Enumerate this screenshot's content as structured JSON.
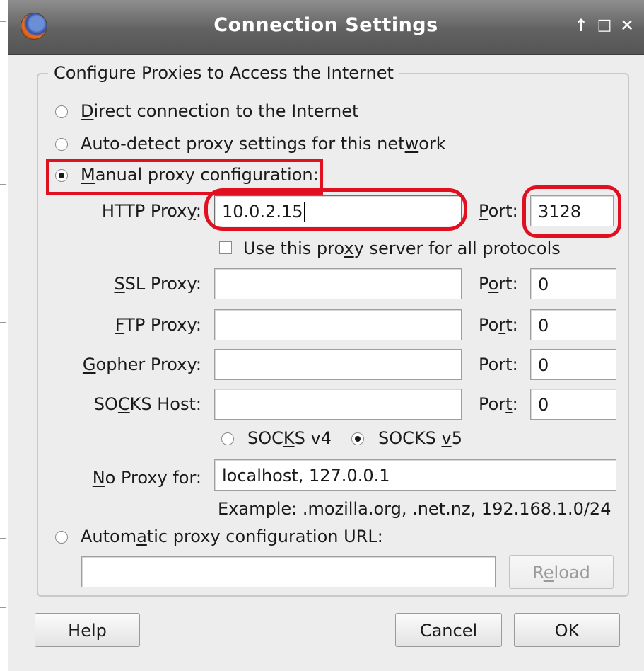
{
  "window": {
    "title": "Connection Settings",
    "controls": {
      "up": "↑",
      "maximize": "□",
      "close": "✕"
    }
  },
  "group": {
    "title": "Configure Proxies to Access the Internet"
  },
  "options": {
    "direct": {
      "before": "",
      "key": "D",
      "after": "irect connection to the Internet"
    },
    "autodetect": {
      "before": "Auto-detect proxy settings for this net",
      "key": "w",
      "after": "ork"
    },
    "manual": {
      "before": "",
      "key": "M",
      "after": "anual proxy configuration:"
    },
    "auto_url": {
      "before": "Autom",
      "key": "a",
      "after": "tic proxy configuration URL:"
    },
    "selected": "manual"
  },
  "proxies": {
    "http": {
      "label_before": "HTTP Prox",
      "label_key": "y",
      "label_after": ":",
      "value": "10.0.2.15",
      "port_before": "",
      "port_key": "P",
      "port_after": "ort:",
      "port": "3128"
    },
    "use_all": {
      "before": "Use this pro",
      "key": "x",
      "after": "y server for all protocols",
      "checked": false
    },
    "ssl": {
      "label_before": "",
      "label_key": "S",
      "label_after": "SL Proxy:",
      "value": "",
      "port_before": "P",
      "port_key": "o",
      "port_after": "rt:",
      "port": "0"
    },
    "ftp": {
      "label_before": "",
      "label_key": "F",
      "label_after": "TP Proxy:",
      "value": "",
      "port_before": "Po",
      "port_key": "r",
      "port_after": "t:",
      "port": "0"
    },
    "gopher": {
      "label_before": "",
      "label_key": "G",
      "label_after": "opher Proxy:",
      "value": "",
      "port_before": "Port:",
      "port_key": "",
      "port_after": "",
      "port": "0"
    },
    "socks": {
      "label_before": "SO",
      "label_key": "C",
      "label_after": "KS Host:",
      "value": "",
      "port_before": "Por",
      "port_key": "t",
      "port_after": ":",
      "port": "0"
    }
  },
  "socks_version": {
    "v4": {
      "before": "SOC",
      "key": "K",
      "after": "S v4"
    },
    "v5": {
      "before": "SOCKS ",
      "key": "v",
      "after": "5"
    },
    "selected": "v5"
  },
  "no_proxy": {
    "label_before": "",
    "label_key": "N",
    "label_after": "o Proxy for:",
    "value": "localhost, 127.0.0.1",
    "example": "Example: .mozilla.org, .net.nz, 192.168.1.0/24"
  },
  "auto_url": {
    "value": "",
    "reload_before": "R",
    "reload_key": "e",
    "reload_after": "load"
  },
  "buttons": {
    "help": "Help",
    "cancel": "Cancel",
    "ok": "OK"
  },
  "colors": {
    "titlebar": "#626262",
    "highlight": "#e01020",
    "window_bg": "#ededed"
  }
}
